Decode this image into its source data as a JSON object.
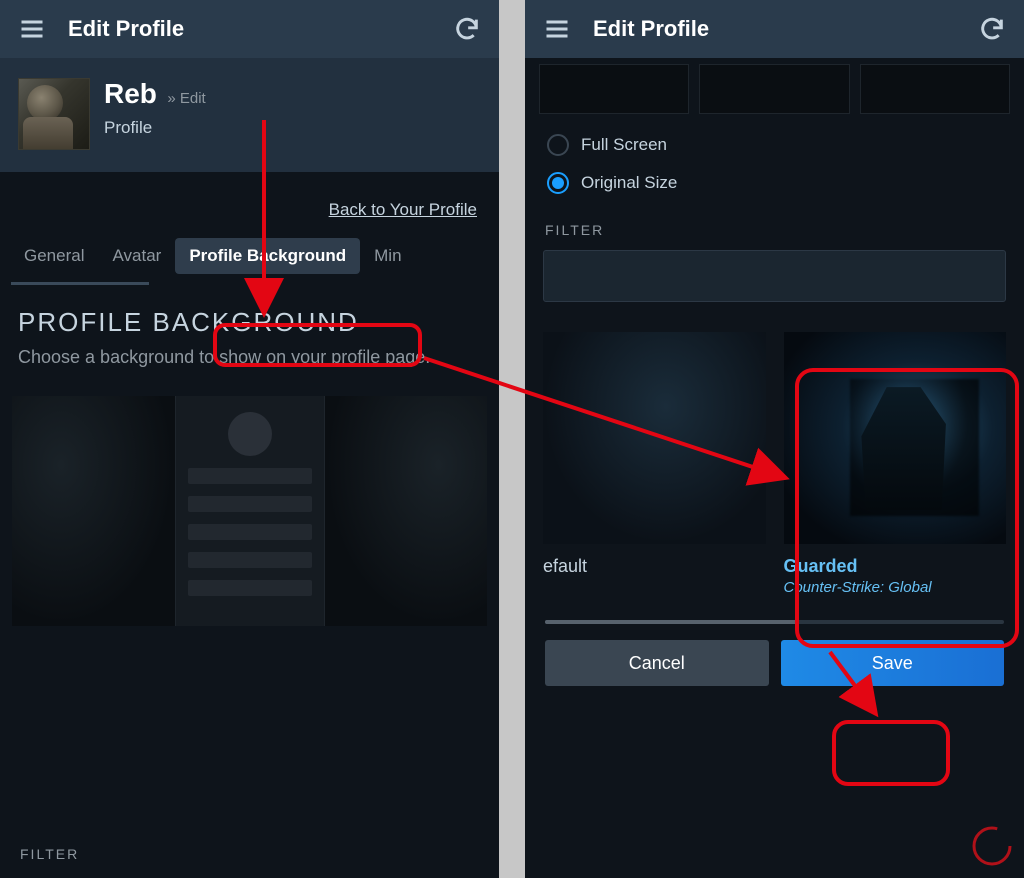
{
  "header": {
    "title": "Edit Profile"
  },
  "profile": {
    "name": "Reb",
    "crumb": "» Edit",
    "sub": "Profile"
  },
  "back_link": "Back to Your Profile",
  "tabs": {
    "general": "General",
    "avatar": "Avatar",
    "profile_bg": "Profile Background",
    "min": "Min"
  },
  "section": {
    "title": "PROFILE BACKGROUND",
    "desc": "Choose a background to show on your profile page."
  },
  "filter_label": "FILTER",
  "radio": {
    "full": "Full Screen",
    "orig": "Original Size"
  },
  "cards": {
    "default": {
      "label": "efault"
    },
    "guarded": {
      "label": "Guarded",
      "sub": "Counter-Strike: Global"
    }
  },
  "buttons": {
    "cancel": "Cancel",
    "save": "Save"
  }
}
